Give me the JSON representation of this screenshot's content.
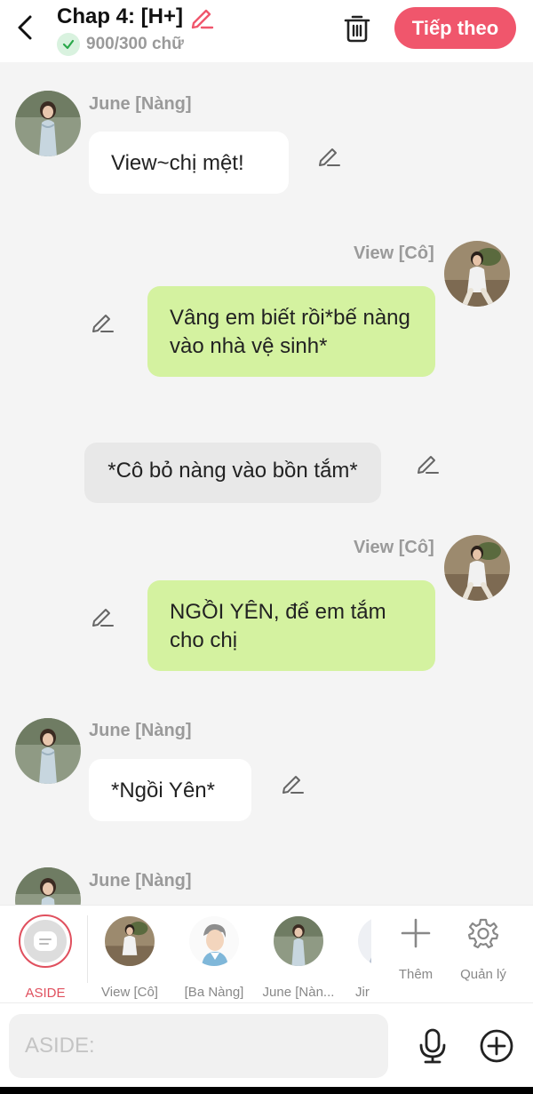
{
  "header": {
    "title": "Chap 4: [H+]",
    "word_count": "900/300 chữ",
    "next_label": "Tiếp theo"
  },
  "messages": [
    {
      "sender": "June [Nàng]",
      "text": "View~chị mệt!",
      "side": "left",
      "style": "white"
    },
    {
      "sender": "View [Cô]",
      "text": "Vâng em biết rồi*bế nàng vào nhà vệ sinh*",
      "side": "right",
      "style": "green"
    },
    {
      "sender": "",
      "text": "*Cô bỏ nàng vào bồn tắm*",
      "side": "center",
      "style": "gray"
    },
    {
      "sender": "View [Cô]",
      "text": "NGỒI YÊN, để em tắm cho chị",
      "side": "right",
      "style": "green"
    },
    {
      "sender": "June [Nàng]",
      "text": "*Ngồi Yên*",
      "side": "left",
      "style": "white"
    },
    {
      "sender": "June [Nàng]",
      "text": "",
      "side": "left",
      "style": "white"
    }
  ],
  "characters": [
    {
      "label": "ASIDE",
      "icon": "aside-icon",
      "selected": true
    },
    {
      "label": "View [Cô]",
      "icon": "avatar"
    },
    {
      "label": "[Ba Nàng]",
      "icon": "avatar"
    },
    {
      "label": "June [Nàn...",
      "icon": "avatar"
    },
    {
      "label": "Jir",
      "icon": "avatar"
    }
  ],
  "tools": {
    "add_label": "Thêm",
    "manage_label": "Quản lý"
  },
  "input": {
    "placeholder": "ASIDE:"
  },
  "colors": {
    "accent": "#f0566c",
    "green_bubble": "#d4f2a0",
    "white_bubble": "#ffffff",
    "gray_bubble": "#e8e8e8",
    "check_green": "#2aa84a"
  }
}
